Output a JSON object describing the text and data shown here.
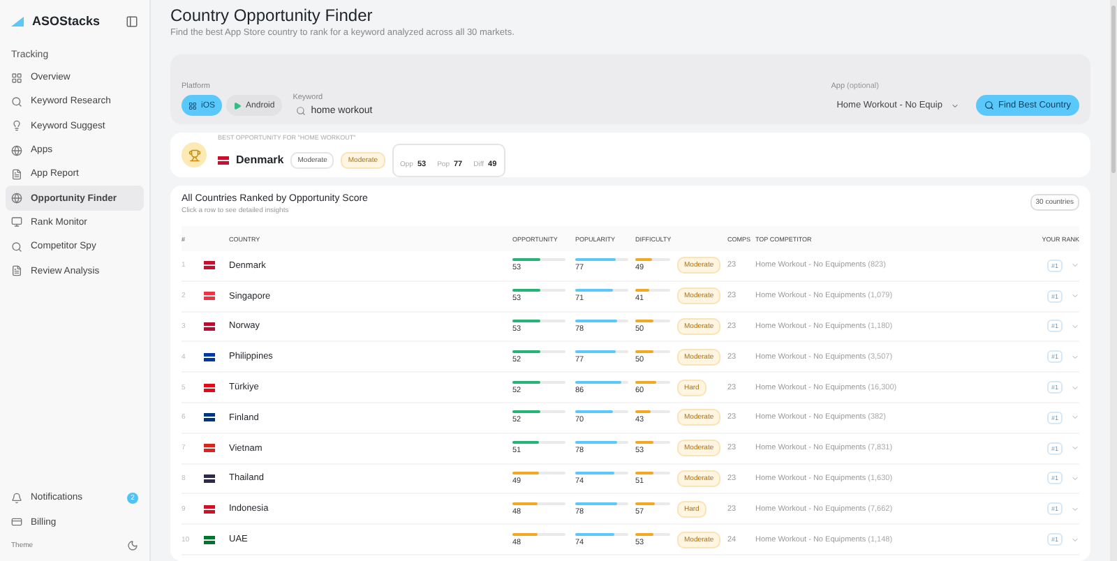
{
  "sidebar": {
    "brand": "ASOStacks",
    "section": "Tracking",
    "items": [
      {
        "label": "Overview",
        "selected": false
      },
      {
        "label": "Keyword Research",
        "selected": false
      },
      {
        "label": "Keyword Suggest",
        "selected": false
      },
      {
        "label": "Apps",
        "selected": false
      },
      {
        "label": "App Report",
        "selected": false
      },
      {
        "label": "Opportunity Finder",
        "selected": true
      },
      {
        "label": "Rank Monitor",
        "selected": false
      },
      {
        "label": "Competitor Spy",
        "selected": false
      },
      {
        "label": "Review Analysis",
        "selected": false
      }
    ],
    "footer": [
      {
        "label": "Notifications",
        "badge": "2"
      },
      {
        "label": "Billing"
      }
    ],
    "theme_label": "Theme"
  },
  "header": {
    "title": "Country Opportunity Finder",
    "subtitle": "Find the best App Store country to rank for a keyword analyzed across all 30 markets."
  },
  "search": {
    "platform_label": "Platform",
    "platforms": [
      {
        "label": "iOS",
        "selected": true
      },
      {
        "label": "Android",
        "selected": false
      }
    ],
    "keyword_label": "Keyword",
    "keyword": "home workout",
    "app_label": "App",
    "app_hint": "(optional)",
    "app": "Home Workout - No Equip",
    "button": "Find Best Country"
  },
  "best": {
    "caption": "BEST OPPORTUNITY FOR \"HOME WORKOUT\"",
    "country": "Denmark",
    "flag": {
      "color": "#c8102e"
    },
    "tags": [
      {
        "label": "Moderate",
        "kind": "neutral"
      },
      {
        "label": "Moderate",
        "kind": "warn"
      }
    ],
    "stats": [
      {
        "label": "Opp",
        "value": "53"
      },
      {
        "label": "Pop",
        "value": "77"
      },
      {
        "label": "Diff",
        "value": "49"
      }
    ]
  },
  "table": {
    "title": "All Countries Ranked by Opportunity Score",
    "subtitle": "Click a row to see detailed insights",
    "count": "30 countries",
    "columns": [
      "#",
      "COUNTRY",
      "OPPORTUNITY",
      "POPULARITY",
      "DIFFICULTY",
      "COMPS",
      "TOP COMPETITOR",
      "YOUR RANK"
    ],
    "rows": [
      {
        "rank": "1",
        "country": "Denmark",
        "color": "#c8102e",
        "opportunity": {
          "value": "53",
          "level": 0.53,
          "color": "#22b573"
        },
        "popularity": {
          "value": "77",
          "level": 0.77
        },
        "difficulty": {
          "value": "49",
          "level": 0.49
        },
        "tag": "Moderate",
        "comps": "23",
        "competitor": "Home Workout - No Equipments",
        "reviews": "(823)",
        "your_rank": "#1"
      },
      {
        "rank": "2",
        "country": "Singapore",
        "color": "#ef3340",
        "opportunity": {
          "value": "53",
          "level": 0.53,
          "color": "#22b573"
        },
        "popularity": {
          "value": "71",
          "level": 0.71
        },
        "difficulty": {
          "value": "41",
          "level": 0.41
        },
        "tag": "Moderate",
        "comps": "23",
        "competitor": "Home Workout - No Equipments",
        "reviews": "(1,079)",
        "your_rank": "#1"
      },
      {
        "rank": "3",
        "country": "Norway",
        "color": "#ba0c2f",
        "opportunity": {
          "value": "53",
          "level": 0.53,
          "color": "#22b573"
        },
        "popularity": {
          "value": "78",
          "level": 0.78
        },
        "difficulty": {
          "value": "50",
          "level": 0.5
        },
        "tag": "Moderate",
        "comps": "23",
        "competitor": "Home Workout - No Equipments",
        "reviews": "(1,180)",
        "your_rank": "#1"
      },
      {
        "rank": "4",
        "country": "Philippines",
        "color": "#0038a8",
        "opportunity": {
          "value": "52",
          "level": 0.52,
          "color": "#22b573"
        },
        "popularity": {
          "value": "77",
          "level": 0.77
        },
        "difficulty": {
          "value": "50",
          "level": 0.5
        },
        "tag": "Moderate",
        "comps": "23",
        "competitor": "Home Workout - No Equipments",
        "reviews": "(3,507)",
        "your_rank": "#1"
      },
      {
        "rank": "5",
        "country": "Türkiye",
        "color": "#e30a17",
        "opportunity": {
          "value": "52",
          "level": 0.52,
          "color": "#22b573"
        },
        "popularity": {
          "value": "86",
          "level": 0.86
        },
        "difficulty": {
          "value": "60",
          "level": 0.6
        },
        "tag": "Hard",
        "comps": "23",
        "competitor": "Home Workout - No Equipments",
        "reviews": "(16,300)",
        "your_rank": "#1"
      },
      {
        "rank": "6",
        "country": "Finland",
        "color": "#003580",
        "opportunity": {
          "value": "52",
          "level": 0.52,
          "color": "#22b573"
        },
        "popularity": {
          "value": "70",
          "level": 0.7
        },
        "difficulty": {
          "value": "43",
          "level": 0.43
        },
        "tag": "Moderate",
        "comps": "23",
        "competitor": "Home Workout - No Equipments",
        "reviews": "(382)",
        "your_rank": "#1"
      },
      {
        "rank": "7",
        "country": "Vietnam",
        "color": "#da251d",
        "opportunity": {
          "value": "51",
          "level": 0.51,
          "color": "#22b573"
        },
        "popularity": {
          "value": "78",
          "level": 0.78
        },
        "difficulty": {
          "value": "53",
          "level": 0.53
        },
        "tag": "Moderate",
        "comps": "23",
        "competitor": "Home Workout - No Equipments",
        "reviews": "(7,831)",
        "your_rank": "#1"
      },
      {
        "rank": "8",
        "country": "Thailand",
        "color": "#2d2a4a",
        "opportunity": {
          "value": "49",
          "level": 0.49,
          "color": "#f5a623"
        },
        "popularity": {
          "value": "74",
          "level": 0.74
        },
        "difficulty": {
          "value": "51",
          "level": 0.51
        },
        "tag": "Moderate",
        "comps": "23",
        "competitor": "Home Workout - No Equipments",
        "reviews": "(1,630)",
        "your_rank": "#1"
      },
      {
        "rank": "9",
        "country": "Indonesia",
        "color": "#ce1126",
        "opportunity": {
          "value": "48",
          "level": 0.48,
          "color": "#f5a623"
        },
        "popularity": {
          "value": "78",
          "level": 0.78
        },
        "difficulty": {
          "value": "57",
          "level": 0.57
        },
        "tag": "Hard",
        "comps": "23",
        "competitor": "Home Workout - No Equipments",
        "reviews": "(7,662)",
        "your_rank": "#1"
      },
      {
        "rank": "10",
        "country": "UAE",
        "color": "#00732f",
        "opportunity": {
          "value": "48",
          "level": 0.48,
          "color": "#f5a623"
        },
        "popularity": {
          "value": "74",
          "level": 0.74
        },
        "difficulty": {
          "value": "53",
          "level": 0.53
        },
        "tag": "Moderate",
        "comps": "24",
        "competitor": "Home Workout - No Equipments",
        "reviews": "(1,148)",
        "your_rank": "#1"
      }
    ]
  }
}
